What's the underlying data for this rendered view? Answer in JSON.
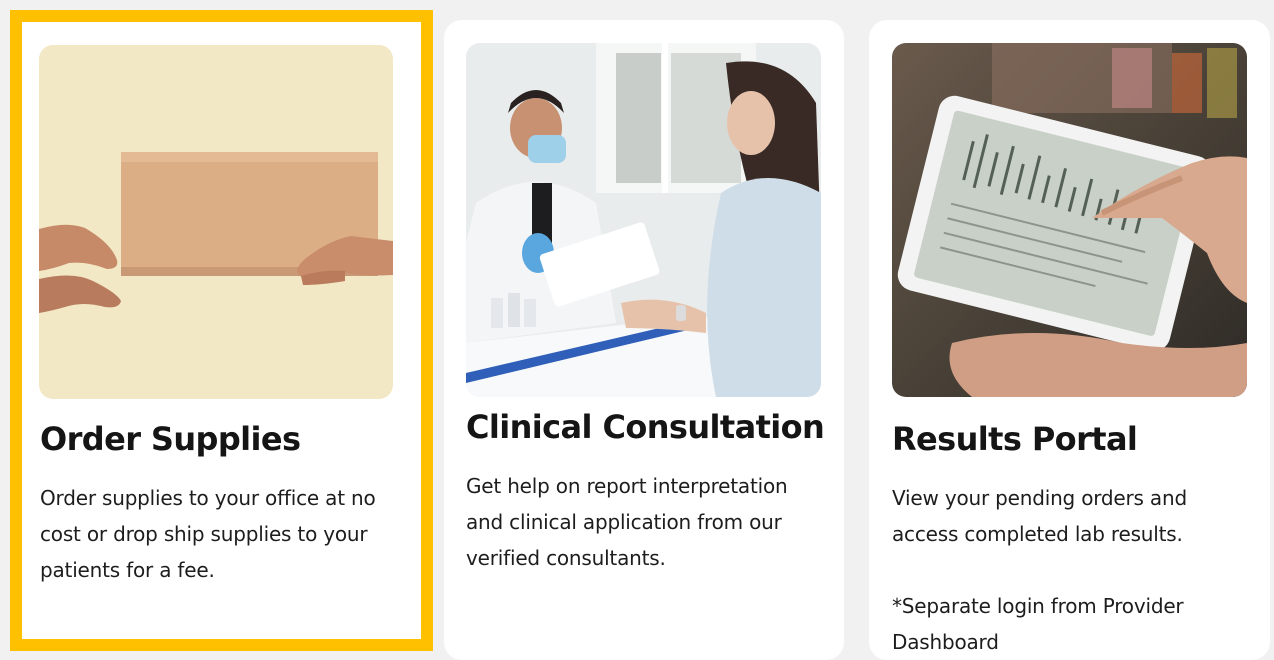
{
  "cards": [
    {
      "title": "Order Supplies",
      "description": "Order supplies to your office at no cost or drop ship supplies to your patients for a fee.",
      "image": "hands-passing-box-photo"
    },
    {
      "title": "Clinical Consultation",
      "description": "Get help on report interpretation and clinical application from our verified consultants.",
      "image": "doctor-patient-consultation-photo"
    },
    {
      "title": "Results Portal",
      "description": "View your pending orders and access completed lab results.",
      "note": "*Separate login from Provider Dashboard",
      "image": "tablet-lab-results-photo"
    }
  ],
  "colors": {
    "selection_outline": "#ffc000",
    "page_background": "#f1f1f2",
    "card_background": "#ffffff"
  }
}
